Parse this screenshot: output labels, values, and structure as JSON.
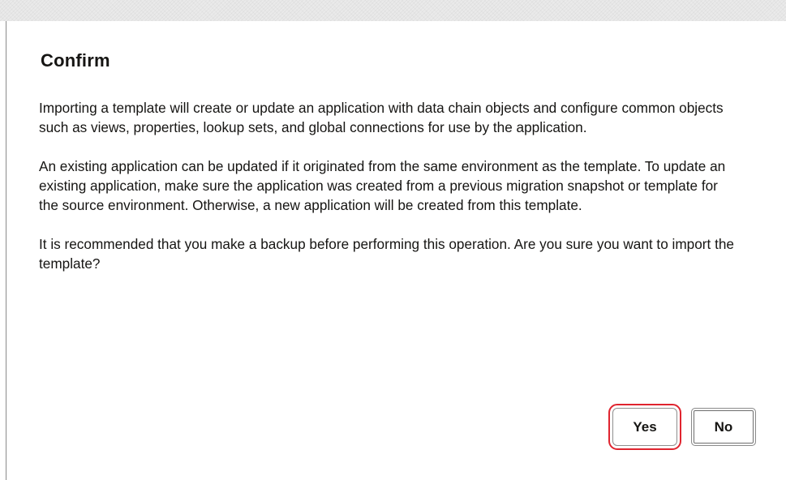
{
  "dialog": {
    "title": "Confirm",
    "paragraphs": [
      "Importing a template will create or update an application with data chain objects and configure common objects such as views, properties, lookup sets, and global connections for use by the application.",
      "An existing application can be updated if it originated from the same environment as the template.  To update an existing application, make sure the application was created from a previous migration snapshot or template for the source environment. Otherwise, a new application will be created from this template.",
      "It is recommended that you make a backup before performing this operation. Are you sure you want to import the template?"
    ],
    "buttons": {
      "yes_label": "Yes",
      "no_label": "No"
    },
    "highlight_color": "#e0242f"
  }
}
